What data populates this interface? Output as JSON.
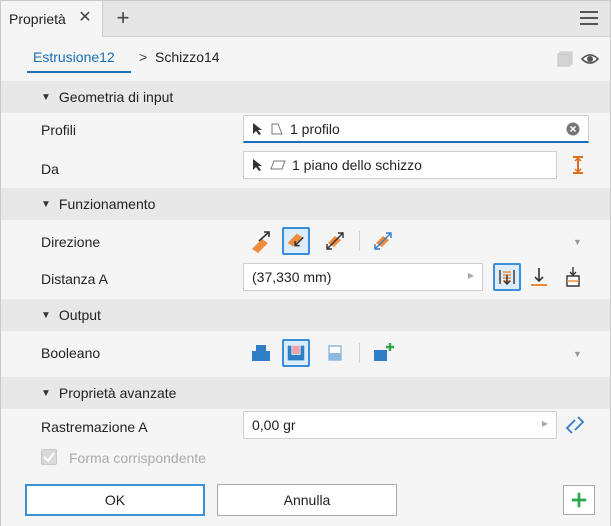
{
  "titlebar": {
    "tab_label": "Proprietà",
    "close_glyph": "✕",
    "add_glyph": "+"
  },
  "breadcrumb": {
    "item1": "Estrusione12",
    "separator": ">",
    "item2": "Schizzo14"
  },
  "sections": {
    "input": {
      "title": "Geometria di input"
    },
    "operation": {
      "title": "Funzionamento"
    },
    "output": {
      "title": "Output"
    },
    "advanced": {
      "title": "Proprietà avanzate"
    }
  },
  "input_geometry": {
    "profiles_label": "Profili",
    "profiles_value": "1 profilo",
    "from_label": "Da",
    "from_value": "1 piano dello schizzo"
  },
  "operation": {
    "direction_label": "Direzione",
    "distance_label": "Distanza A",
    "distance_value": "(37,330 mm)"
  },
  "output": {
    "boolean_label": "Booleano"
  },
  "advanced": {
    "taper_label": "Rastremazione A",
    "taper_value": "0,00 gr",
    "match_shape_label": "Forma corrispondente",
    "match_shape_checked": true
  },
  "footer": {
    "ok_label": "OK",
    "cancel_label": "Annulla",
    "add_glyph": "+"
  },
  "colors": {
    "accent": "#1a6fb5",
    "selected_border": "#3b8fd6",
    "orange": "#f08a3c",
    "blue_icon": "#2f7fc6",
    "green": "#2ba84a"
  },
  "icons": [
    "close-icon",
    "plus-icon",
    "hamburger-menu-icon",
    "square-icon",
    "eye-icon",
    "cursor-arrow-icon",
    "profile-icon",
    "plane-icon",
    "flip-icon",
    "clear-icon",
    "direction-default-icon",
    "direction-flipped-icon",
    "direction-symmetric-icon",
    "direction-asymmetric-icon",
    "distance-extent-icon",
    "to-extent-icon",
    "between-extent-icon",
    "join-icon",
    "cut-icon",
    "intersect-icon",
    "new-solid-icon",
    "taper-flip-icon",
    "add-icon"
  ]
}
